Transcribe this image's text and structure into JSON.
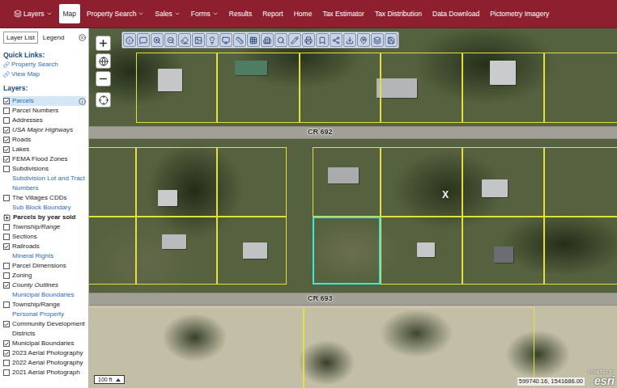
{
  "nav": [
    {
      "label": "Layers",
      "kind": "icon-menu",
      "dropdown": true,
      "selected": false
    },
    {
      "label": "Map",
      "kind": "text",
      "dropdown": false,
      "selected": true
    },
    {
      "label": "Property Search",
      "kind": "text",
      "dropdown": true,
      "selected": false
    },
    {
      "label": "Sales",
      "kind": "text",
      "dropdown": true,
      "selected": false
    },
    {
      "label": "Forms",
      "kind": "text",
      "dropdown": true,
      "selected": false
    },
    {
      "label": "Results",
      "kind": "text",
      "dropdown": false,
      "selected": false
    },
    {
      "label": "Report",
      "kind": "text",
      "dropdown": false,
      "selected": false
    },
    {
      "label": "Home",
      "kind": "text",
      "dropdown": false,
      "selected": false
    },
    {
      "label": "Tax Estimator",
      "kind": "text",
      "dropdown": false,
      "selected": false
    },
    {
      "label": "Tax Distribution",
      "kind": "text",
      "dropdown": false,
      "selected": false
    },
    {
      "label": "Data Download",
      "kind": "text",
      "dropdown": false,
      "selected": false
    },
    {
      "label": "Pictometry Imagery",
      "kind": "text",
      "dropdown": false,
      "selected": false
    }
  ],
  "sidebar": {
    "tabs": [
      {
        "label": "Layer List",
        "selected": true
      },
      {
        "label": "Legend",
        "selected": false
      }
    ],
    "quick_links_title": "Quick Links:",
    "quick_links": [
      "Property Search",
      "View Map"
    ],
    "layers_title": "Layers:",
    "layers": [
      {
        "label": "Parcels",
        "kind": "checkbox",
        "checked": true,
        "italic": false,
        "selected": true
      },
      {
        "label": "Parcel Numbers",
        "kind": "checkbox",
        "checked": false,
        "italic": false,
        "selected": false
      },
      {
        "label": "Addresses",
        "kind": "checkbox",
        "checked": false,
        "italic": false,
        "selected": false
      },
      {
        "label": "USA Major Highways",
        "kind": "checkbox",
        "checked": true,
        "italic": true,
        "selected": false
      },
      {
        "label": "Roads",
        "kind": "checkbox",
        "checked": true,
        "italic": false,
        "selected": false
      },
      {
        "label": "Lakes",
        "kind": "checkbox",
        "checked": true,
        "italic": false,
        "selected": false
      },
      {
        "label": "FEMA Flood Zones",
        "kind": "checkbox",
        "checked": true,
        "italic": false,
        "selected": false
      },
      {
        "label": "Subdivisions",
        "kind": "checkbox",
        "checked": false,
        "italic": false,
        "selected": false
      },
      {
        "label": "Subdivision Lot and Tract Numbers",
        "kind": "link",
        "italic": false,
        "selected": false
      },
      {
        "label": "The Villages CDDs",
        "kind": "checkbox",
        "checked": false,
        "italic": false,
        "selected": false
      },
      {
        "label": "Sub Block Boundary",
        "kind": "link",
        "italic": false,
        "selected": false
      },
      {
        "label": "Parcels by year sold",
        "kind": "group",
        "expanded": false,
        "italic": false,
        "selected": false
      },
      {
        "label": "Township/Range",
        "kind": "checkbox",
        "checked": false,
        "italic": true,
        "selected": false
      },
      {
        "label": "Sections",
        "kind": "checkbox",
        "checked": false,
        "italic": false,
        "selected": false
      },
      {
        "label": "Railroads",
        "kind": "checkbox",
        "checked": true,
        "italic": false,
        "selected": false
      },
      {
        "label": "Mineral Rights",
        "kind": "link",
        "italic": false,
        "selected": false
      },
      {
        "label": "Parcel Dimensions",
        "kind": "checkbox",
        "checked": false,
        "italic": false,
        "selected": false
      },
      {
        "label": "Zoning",
        "kind": "checkbox",
        "checked": false,
        "italic": false,
        "selected": false
      },
      {
        "label": "County Outlines",
        "kind": "checkbox",
        "checked": true,
        "italic": true,
        "selected": false
      },
      {
        "label": "Municipal Boundaries",
        "kind": "link",
        "italic": false,
        "selected": false
      },
      {
        "label": "Township/Range",
        "kind": "checkbox",
        "checked": false,
        "italic": false,
        "selected": false
      },
      {
        "label": "Personal Property",
        "kind": "link",
        "italic": false,
        "selected": false
      },
      {
        "label": "Community Development Districts",
        "kind": "checkbox",
        "checked": true,
        "italic": false,
        "selected": false
      },
      {
        "label": "Municipal Boundaries",
        "kind": "checkbox",
        "checked": true,
        "italic": false,
        "selected": false
      },
      {
        "label": "2023 Aerial Photography",
        "kind": "checkbox",
        "checked": true,
        "italic": false,
        "selected": false
      },
      {
        "label": "2022 Aerial Photography",
        "kind": "checkbox",
        "checked": false,
        "italic": false,
        "selected": false
      },
      {
        "label": "2021 Aerial Photograph",
        "kind": "checkbox",
        "checked": false,
        "italic": false,
        "selected": false
      }
    ]
  },
  "map": {
    "roads": [
      "CR 692",
      "CR 693"
    ],
    "marker": "X",
    "parcels": [
      {
        "selected": false
      },
      {
        "selected": false
      },
      {
        "selected": false
      },
      {
        "selected": false
      },
      {
        "selected": false
      },
      {
        "selected": false
      },
      {
        "selected": false
      },
      {
        "selected": false
      },
      {
        "selected": false
      },
      {
        "selected": false
      },
      {
        "selected": false
      },
      {
        "selected": false
      },
      {
        "selected": false
      },
      {
        "selected": false
      },
      {
        "selected": false
      },
      {
        "selected": false
      },
      {
        "selected": true
      },
      {
        "selected": false
      },
      {
        "selected": false
      },
      {
        "selected": false
      },
      {
        "selected": false
      },
      {
        "selected": false
      }
    ],
    "scale": "100 ft",
    "coordinates": "599740.16, 1541686.00",
    "attribution": {
      "top": "POWERED BY",
      "logo": "esri"
    }
  }
}
